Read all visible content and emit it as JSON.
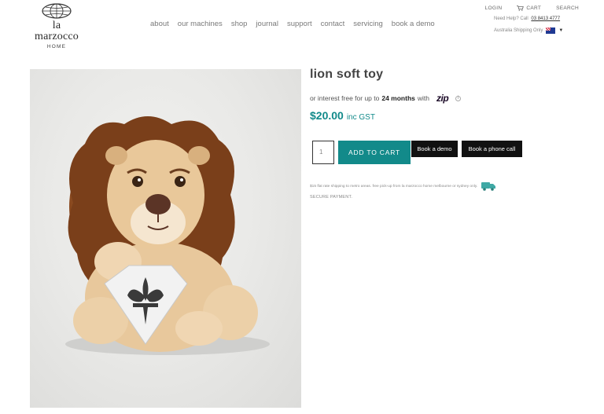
{
  "header": {
    "logo": {
      "brand": "la marzocco",
      "sub": "HOME"
    },
    "nav": [
      "about",
      "our machines",
      "shop",
      "journal",
      "support",
      "contact",
      "servicing",
      "book a demo"
    ],
    "util": {
      "login": "LOGIN",
      "cart": "CART",
      "search": "SEARCH"
    },
    "help": {
      "text": "Need Help? Call",
      "phone": "03 8413 4777"
    },
    "shipping_region": "Australia Shipping Only",
    "flag_icon": "australia-flag-icon"
  },
  "product": {
    "title": "lion soft toy",
    "finance": {
      "prefix": "or interest free for up to",
      "term": "24 months",
      "with": "with",
      "provider": "zip"
    },
    "price": {
      "amount": "$20.00",
      "tax": "inc GST"
    },
    "quantity": "1",
    "buttons": {
      "add_to_cart": "ADD TO CART",
      "book_demo": "Book a demo",
      "book_call": "Book a phone call"
    },
    "shipping_note": "$15 flat rate shipping to metro areas. free pick-up from la marzocco home melbourne or sydney only.",
    "secure": "SECURE PAYMENT."
  },
  "colors": {
    "accent": "#128a8a",
    "button_dark": "#111111",
    "zip_purple": "#aa8fff"
  }
}
